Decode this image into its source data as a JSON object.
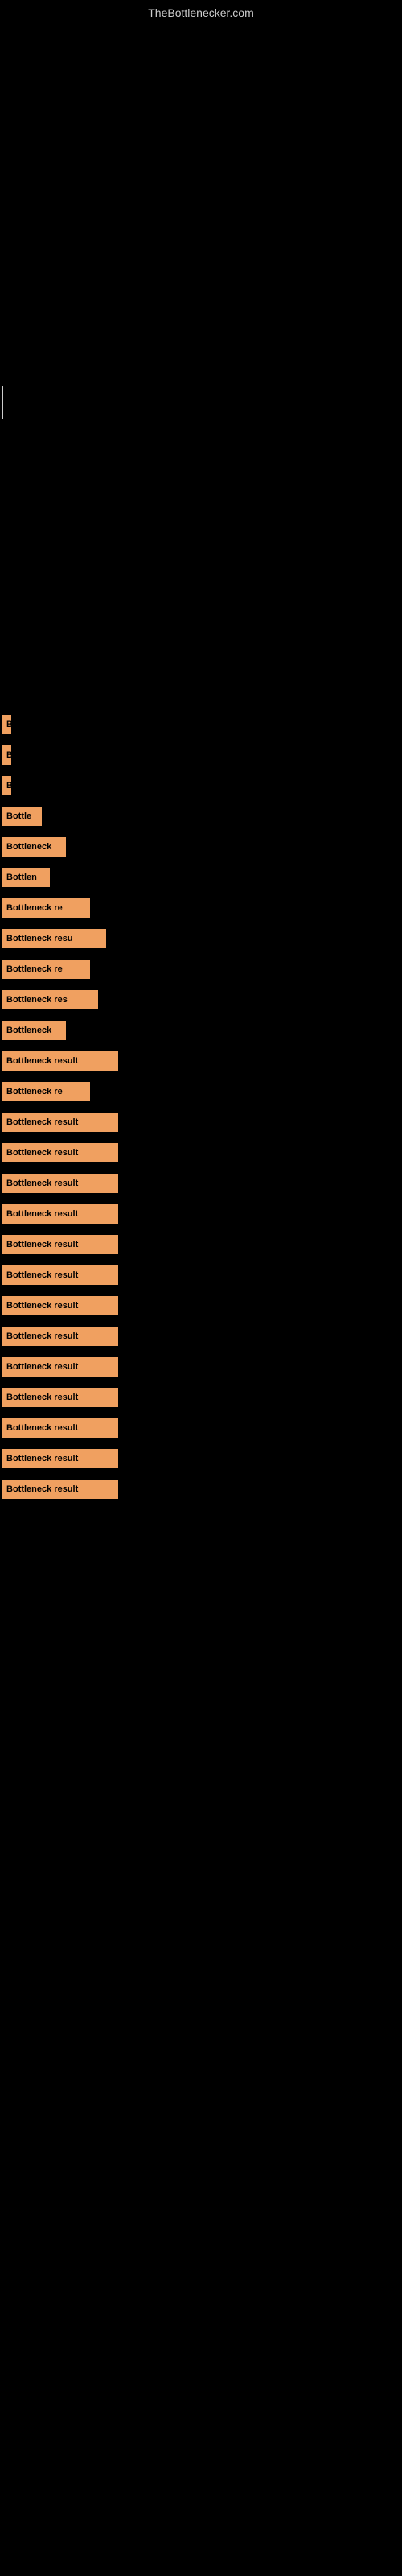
{
  "site": {
    "title": "TheBottlenecker.com"
  },
  "bars": [
    {
      "id": 1,
      "label": "B",
      "width": 12
    },
    {
      "id": 2,
      "label": "B",
      "width": 12
    },
    {
      "id": 3,
      "label": "B",
      "width": 12
    },
    {
      "id": 4,
      "label": "Bottle",
      "width": 50
    },
    {
      "id": 5,
      "label": "Bottleneck",
      "width": 80
    },
    {
      "id": 6,
      "label": "Bottlen",
      "width": 60
    },
    {
      "id": 7,
      "label": "Bottleneck re",
      "width": 110
    },
    {
      "id": 8,
      "label": "Bottleneck resu",
      "width": 130
    },
    {
      "id": 9,
      "label": "Bottleneck re",
      "width": 110
    },
    {
      "id": 10,
      "label": "Bottleneck res",
      "width": 120
    },
    {
      "id": 11,
      "label": "Bottleneck",
      "width": 80
    },
    {
      "id": 12,
      "label": "Bottleneck result",
      "width": 145
    },
    {
      "id": 13,
      "label": "Bottleneck re",
      "width": 110
    },
    {
      "id": 14,
      "label": "Bottleneck result",
      "width": 145
    },
    {
      "id": 15,
      "label": "Bottleneck result",
      "width": 145
    },
    {
      "id": 16,
      "label": "Bottleneck result",
      "width": 145
    },
    {
      "id": 17,
      "label": "Bottleneck result",
      "width": 145
    },
    {
      "id": 18,
      "label": "Bottleneck result",
      "width": 145
    },
    {
      "id": 19,
      "label": "Bottleneck result",
      "width": 145
    },
    {
      "id": 20,
      "label": "Bottleneck result",
      "width": 145
    },
    {
      "id": 21,
      "label": "Bottleneck result",
      "width": 145
    },
    {
      "id": 22,
      "label": "Bottleneck result",
      "width": 145
    },
    {
      "id": 23,
      "label": "Bottleneck result",
      "width": 145
    },
    {
      "id": 24,
      "label": "Bottleneck result",
      "width": 145
    },
    {
      "id": 25,
      "label": "Bottleneck result",
      "width": 145
    },
    {
      "id": 26,
      "label": "Bottleneck result",
      "width": 145
    }
  ]
}
